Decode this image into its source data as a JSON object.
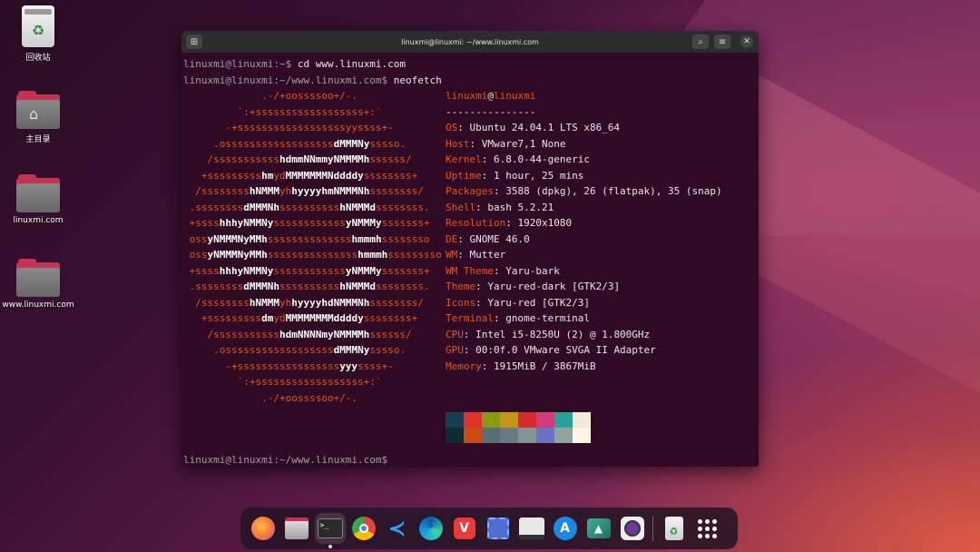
{
  "desktop": {
    "icons": [
      {
        "label": "回收站",
        "icon": "trash-icon"
      },
      {
        "label": "主目录",
        "icon": "home-folder-icon"
      },
      {
        "label": "linuxmi.com",
        "icon": "folder-icon"
      },
      {
        "label": "www.linuxmi.com",
        "icon": "folder-icon"
      }
    ]
  },
  "terminal": {
    "title": "linuxmi@linuxmi: ~/www.linuxmi.com",
    "prompt_home": "linuxmi@linuxmi:~$",
    "cmd1": " cd www.linuxmi.com",
    "prompt_dir": "linuxmi@linuxmi:~/www.linuxmi.com$",
    "cmd2": " neofetch",
    "logo": [
      [
        [
          "o",
          "             .-/+oossssoo+/-."
        ]
      ],
      [
        [
          "o",
          "         `:+ssssssssssssssssss+:`"
        ]
      ],
      [
        [
          "o",
          "       -+ssssssssssssssssssyyssss+-"
        ]
      ],
      [
        [
          "o",
          "     .ossssssssssssssssss"
        ],
        [
          "w",
          "dMMMNy"
        ],
        [
          "o",
          "sssso."
        ]
      ],
      [
        [
          "o",
          "    /sssssssssss"
        ],
        [
          "w",
          "hdmmNNmmyNMMMMh"
        ],
        [
          "o",
          "ssssss/"
        ]
      ],
      [
        [
          "o",
          "   +sssssssss"
        ],
        [
          "w",
          "hm"
        ],
        [
          "o",
          "yd"
        ],
        [
          "w",
          "MMMMMMMNddddy"
        ],
        [
          "o",
          "ssssssss+"
        ]
      ],
      [
        [
          "o",
          "  /ssssssss"
        ],
        [
          "w",
          "hNMMM"
        ],
        [
          "o",
          "yh"
        ],
        [
          "w",
          "hyyyyhmNMMMNh"
        ],
        [
          "o",
          "ssssssss/"
        ]
      ],
      [
        [
          "o",
          " .ssssssss"
        ],
        [
          "w",
          "dMMMNh"
        ],
        [
          "o",
          "ssssssssss"
        ],
        [
          "w",
          "hNMMMd"
        ],
        [
          "o",
          "ssssssss."
        ]
      ],
      [
        [
          "o",
          " +ssss"
        ],
        [
          "w",
          "hhhyNMMNy"
        ],
        [
          "o",
          "ssssssssssss"
        ],
        [
          "w",
          "yNMMMy"
        ],
        [
          "o",
          "sssssss+"
        ]
      ],
      [
        [
          "o",
          " oss"
        ],
        [
          "w",
          "yNMMMNyMMh"
        ],
        [
          "o",
          "ssssssssssssss"
        ],
        [
          "w",
          "hmmmh"
        ],
        [
          "o",
          "ssssssso"
        ]
      ],
      [
        [
          "o",
          " oss"
        ],
        [
          "w",
          "yNMMMNyMMh"
        ],
        [
          "o",
          "sssssssssssssss"
        ],
        [
          "w",
          "hmmmh"
        ],
        [
          "o",
          "sssssssso"
        ]
      ],
      [
        [
          "o",
          " +ssss"
        ],
        [
          "w",
          "hhhyNMMNy"
        ],
        [
          "o",
          "ssssssssssss"
        ],
        [
          "w",
          "yNMMMy"
        ],
        [
          "o",
          "sssssss+"
        ]
      ],
      [
        [
          "o",
          " .ssssssss"
        ],
        [
          "w",
          "dMMMNh"
        ],
        [
          "o",
          "ssssssssss"
        ],
        [
          "w",
          "hNMMMd"
        ],
        [
          "o",
          "ssssssss."
        ]
      ],
      [
        [
          "o",
          "  /ssssssss"
        ],
        [
          "w",
          "hNMMM"
        ],
        [
          "o",
          "yh"
        ],
        [
          "w",
          "hyyyyhdNMMMNh"
        ],
        [
          "o",
          "ssssssss/"
        ]
      ],
      [
        [
          "o",
          "   +sssssssss"
        ],
        [
          "w",
          "dm"
        ],
        [
          "o",
          "yd"
        ],
        [
          "w",
          "MMMMMMMMddddy"
        ],
        [
          "o",
          "ssssssss+"
        ]
      ],
      [
        [
          "o",
          "    /sssssssssss"
        ],
        [
          "w",
          "hdmNNNNmyNMMMMh"
        ],
        [
          "o",
          "ssssss/"
        ]
      ],
      [
        [
          "o",
          "     .ossssssssssssssssss"
        ],
        [
          "w",
          "dMMMNy"
        ],
        [
          "o",
          "sssso."
        ]
      ],
      [
        [
          "o",
          "       -+sssssssssssssssss"
        ],
        [
          "w",
          "yyy"
        ],
        [
          "o",
          "ssss+-"
        ]
      ],
      [
        [
          "o",
          "         `:+ssssssssssssssssss+:`"
        ]
      ],
      [
        [
          "o",
          "             .-/+oossssoo+/-."
        ]
      ]
    ],
    "info_header_user": "linuxmi",
    "info_header_at": "@",
    "info_header_host": "linuxmi",
    "info_separator": "---------------",
    "info": [
      {
        "key": "OS",
        "value": "Ubuntu 24.04.1 LTS x86_64"
      },
      {
        "key": "Host",
        "value": "VMware7,1 None"
      },
      {
        "key": "Kernel",
        "value": "6.8.0-44-generic"
      },
      {
        "key": "Uptime",
        "value": "1 hour, 25 mins"
      },
      {
        "key": "Packages",
        "value": "3588 (dpkg), 26 (flatpak), 35 (snap)"
      },
      {
        "key": "Shell",
        "value": "bash 5.2.21"
      },
      {
        "key": "Resolution",
        "value": "1920x1080"
      },
      {
        "key": "DE",
        "value": "GNOME 46.0"
      },
      {
        "key": "WM",
        "value": "Mutter"
      },
      {
        "key": "WM Theme",
        "value": "Yaru-bark"
      },
      {
        "key": "Theme",
        "value": "Yaru-red-dark [GTK2/3]"
      },
      {
        "key": "Icons",
        "value": "Yaru-red [GTK2/3]"
      },
      {
        "key": "Terminal",
        "value": "gnome-terminal"
      },
      {
        "key": "CPU",
        "value": "Intel i5-8250U (2) @ 1.800GHz"
      },
      {
        "key": "GPU",
        "value": "00:0f.0 VMware SVGA II Adapter"
      },
      {
        "key": "Memory",
        "value": "1915MiB / 3867MiB"
      }
    ],
    "palette_top": [
      "#173f4f",
      "#e0322d",
      "#8b9a16",
      "#c7941a",
      "#d72b2b",
      "#d43b7d",
      "#2aa198",
      "#f0ecd8"
    ],
    "palette_bottom": [
      "#0d2a35",
      "#cb4b16",
      "#586e75",
      "#657b83",
      "#839496",
      "#6c71c4",
      "#93a1a1",
      "#fdf6e3"
    ],
    "final_prompt": "linuxmi@linuxmi:~/www.linuxmi.com$"
  },
  "dock": {
    "apps": [
      {
        "name": "firefox-icon"
      },
      {
        "name": "files-icon"
      },
      {
        "name": "terminal-icon",
        "active": true
      },
      {
        "name": "chrome-icon"
      },
      {
        "name": "vscode-icon"
      },
      {
        "name": "edge-icon"
      },
      {
        "name": "vivaldi-icon"
      },
      {
        "name": "screenshot-icon"
      },
      {
        "name": "drive-icon"
      },
      {
        "name": "app-center-icon"
      },
      {
        "name": "cap-icon"
      },
      {
        "name": "camera-icon"
      },
      {
        "name": "trash-icon"
      },
      {
        "name": "show-apps-icon"
      }
    ]
  }
}
